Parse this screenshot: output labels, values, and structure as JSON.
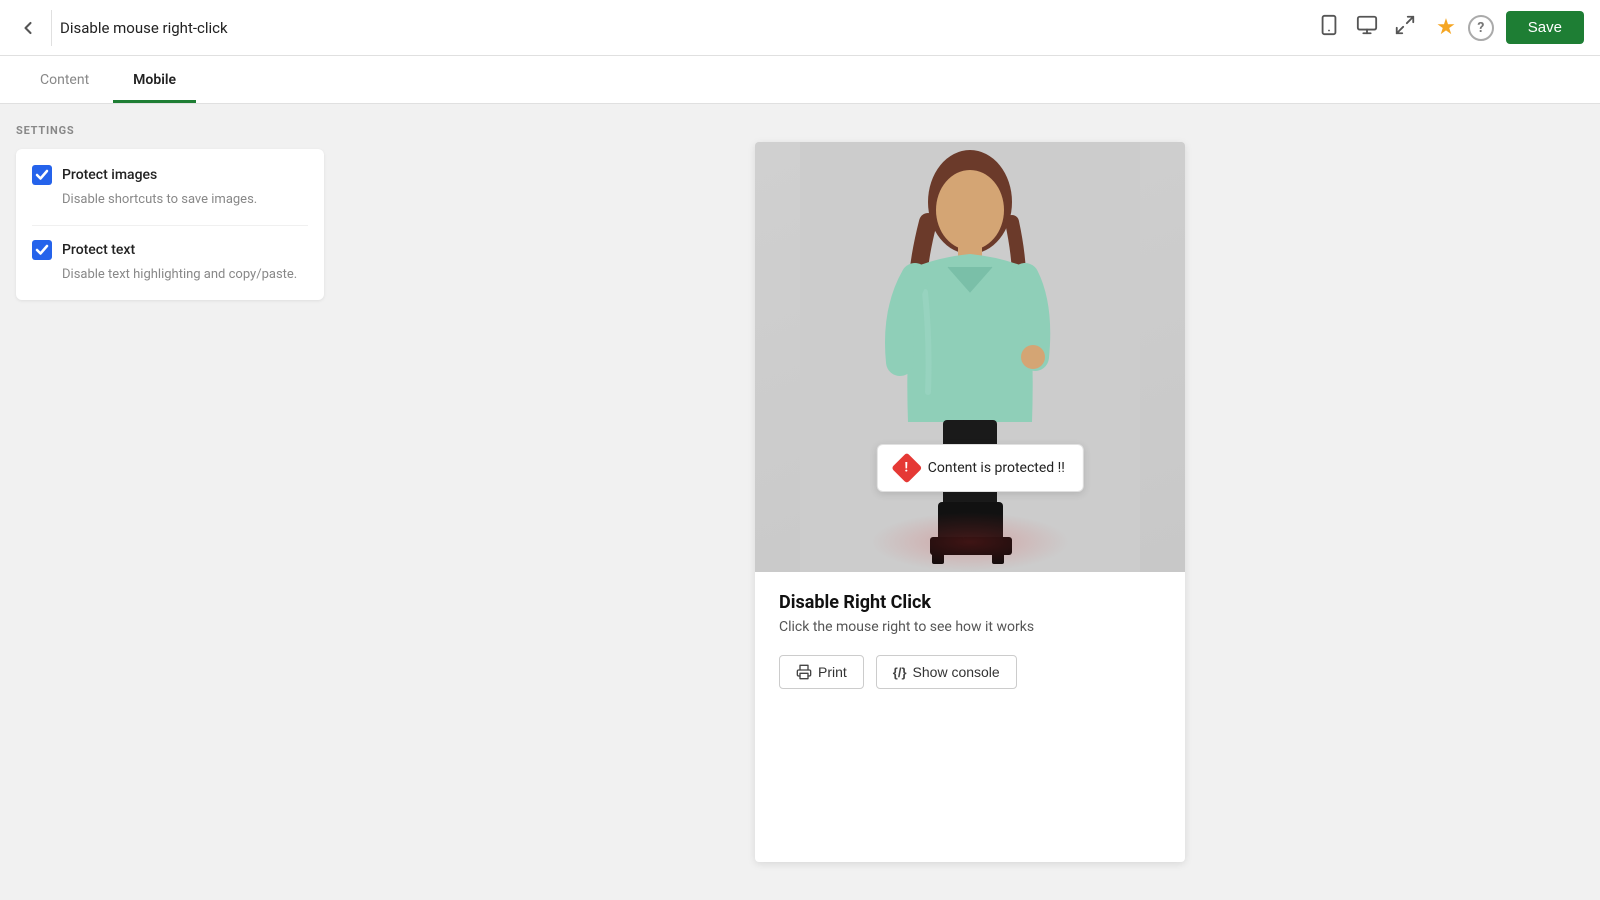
{
  "header": {
    "title": "Disable mouse right-click",
    "save_label": "Save"
  },
  "tabs": [
    {
      "id": "content",
      "label": "Content",
      "active": false
    },
    {
      "id": "mobile",
      "label": "Mobile",
      "active": true
    }
  ],
  "settings": {
    "section_label": "SETTINGS",
    "items": [
      {
        "id": "protect-images",
        "title": "Protect images",
        "description": "Disable shortcuts to save images.",
        "checked": true
      },
      {
        "id": "protect-text",
        "title": "Protect text",
        "description": "Disable text highlighting and copy/paste.",
        "checked": true
      }
    ]
  },
  "preview": {
    "tooltip_text": "Content is protected !!",
    "title": "Disable Right Click",
    "subtitle": "Click the mouse right to see how it works",
    "buttons": [
      {
        "id": "print",
        "icon": "🖨",
        "label": "Print"
      },
      {
        "id": "show-console",
        "icon": "{/}",
        "label": "Show console"
      }
    ]
  },
  "icons": {
    "back": "⬅",
    "mobile": "📱",
    "desktop": "🖥",
    "expand": "⛶",
    "star": "★",
    "help": "?"
  }
}
